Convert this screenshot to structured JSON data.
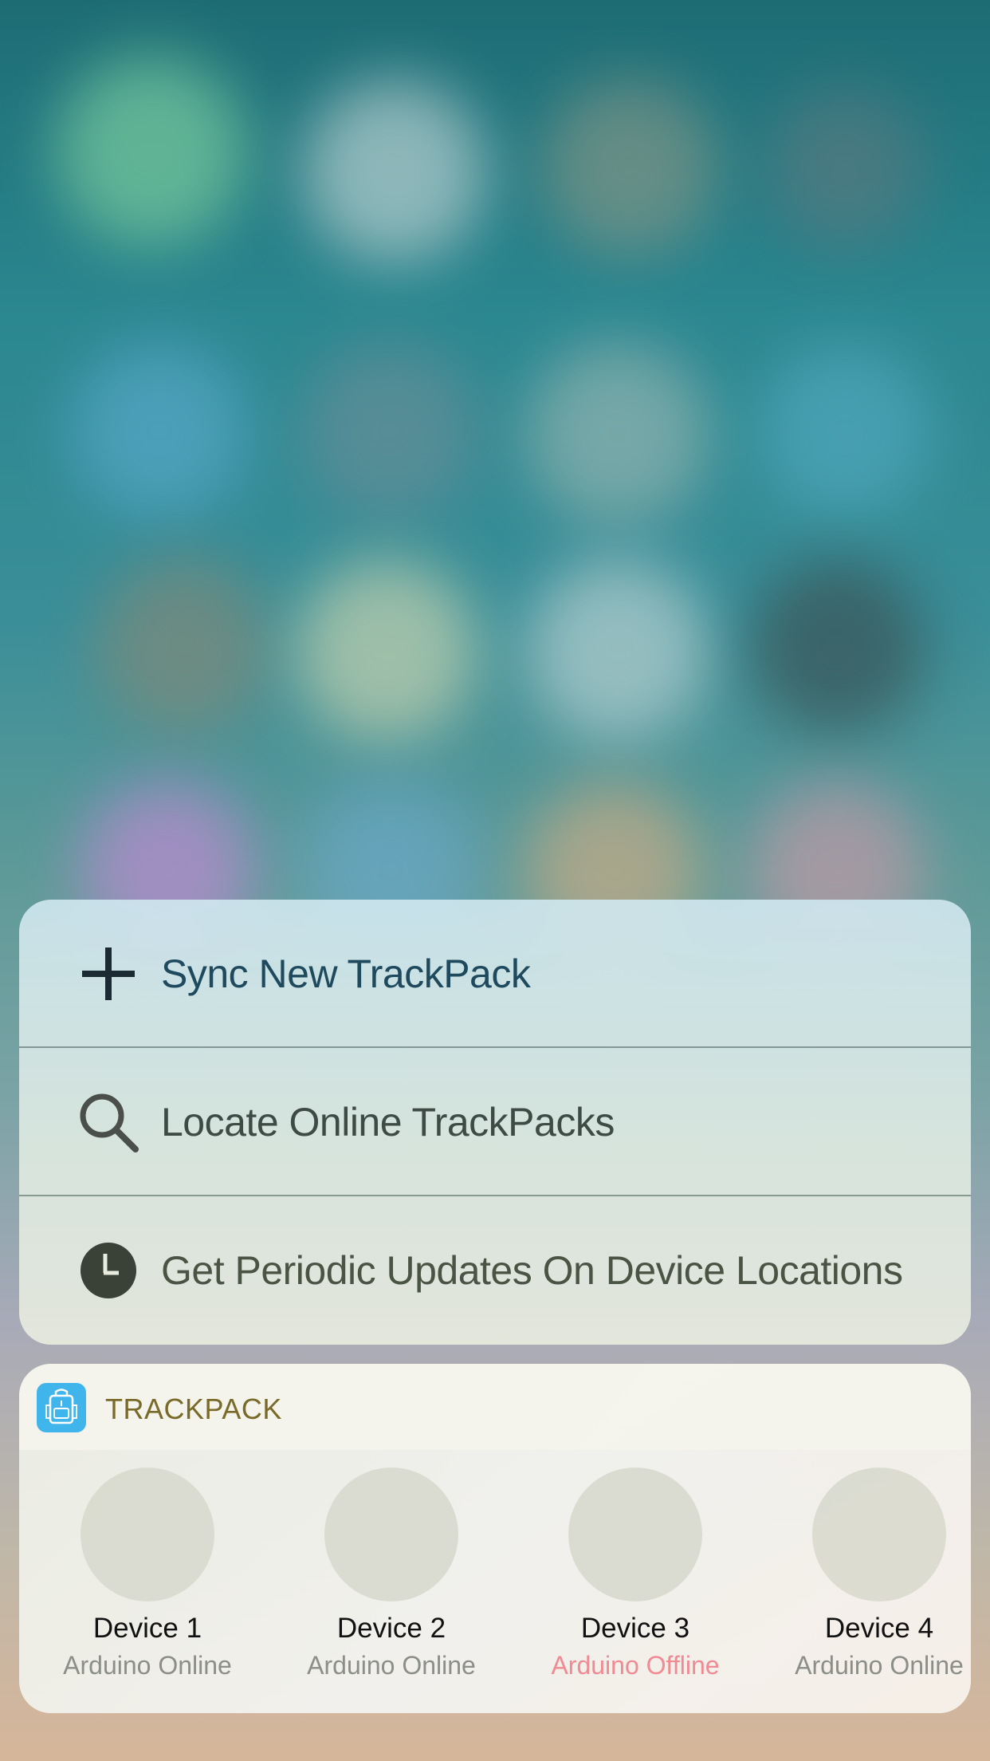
{
  "menu": {
    "items": [
      {
        "label": "Sync New TrackPack",
        "icon": "plus-icon"
      },
      {
        "label": "Locate Online TrackPacks",
        "icon": "search-icon"
      },
      {
        "label": "Get Periodic Updates On Device Locations",
        "icon": "clock-icon"
      }
    ]
  },
  "widget": {
    "app_name": "TRACKPACK",
    "app_icon": "backpack-icon",
    "devices": [
      {
        "name": "Device 1",
        "status": "Arduino Online",
        "online": true
      },
      {
        "name": "Device 2",
        "status": "Arduino Online",
        "online": true
      },
      {
        "name": "Device 3",
        "status": "Arduino Offline",
        "online": false
      },
      {
        "name": "Device 4",
        "status": "Arduino Online",
        "online": true
      }
    ]
  },
  "colors": {
    "accent": "#3fb5ec",
    "offline": "#f08a93",
    "menu_text": "#4a5a52"
  }
}
